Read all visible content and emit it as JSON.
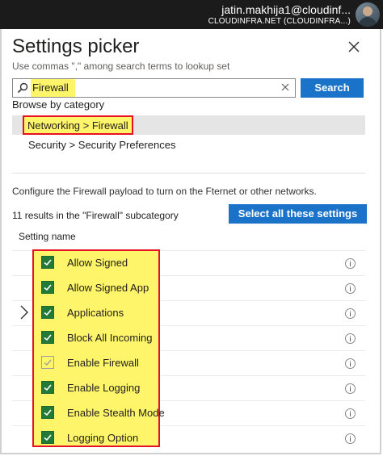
{
  "account": {
    "name": "jatin.makhija1@cloudinf...",
    "tenant": "CLOUDINFRA.NET (CLOUDINFRA...)"
  },
  "panel": {
    "title": "Settings picker",
    "subtitle": "Use commas \",\" among search terms to lookup set",
    "search_value": "Firewall",
    "search_button": "Search",
    "browse_label": "Browse by category",
    "categories": [
      {
        "label": "Networking > Firewall",
        "selected": true
      },
      {
        "label": "Security > Security Preferences",
        "selected": false
      }
    ],
    "description": "Configure the Firewall payload to turn on the Fternet or other networks.",
    "results_text": "11 results in the \"Firewall\" subcategory",
    "select_all_button": "Select all these settings",
    "column_header": "Setting name",
    "settings": [
      {
        "label": "Allow Signed",
        "checked": true
      },
      {
        "label": "Allow Signed App",
        "checked": true
      },
      {
        "label": "Applications",
        "checked": true
      },
      {
        "label": "Block All Incoming",
        "checked": true
      },
      {
        "label": "Enable Firewall",
        "checked": "dimmed"
      },
      {
        "label": "Enable Logging",
        "checked": true
      },
      {
        "label": "Enable Stealth Mode",
        "checked": true
      },
      {
        "label": "Logging Option",
        "checked": true
      }
    ]
  },
  "colors": {
    "accent": "#1a73c9",
    "highlight": "#fff56a",
    "outline": "#e81123",
    "checkbox": "#217a35"
  },
  "icons": [
    "search-icon",
    "close-icon",
    "clear-icon",
    "chevron-right-icon",
    "info-icon",
    "checkmark-icon",
    "avatar"
  ]
}
